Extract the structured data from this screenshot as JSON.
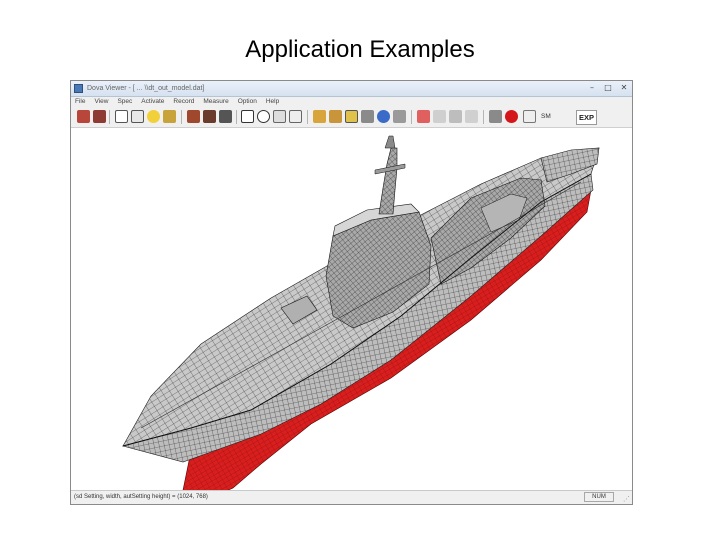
{
  "slide": {
    "title": "Application Examples"
  },
  "window": {
    "title": "Dova Viewer - [ ... \\\\dt_out_model.dat]",
    "buttons": {
      "minimize": "–",
      "maximize": "□",
      "close": "✕"
    }
  },
  "menu": [
    "File",
    "View",
    "Spec",
    "Activate",
    "Record",
    "Measure",
    "Option",
    "Help"
  ],
  "toolbar": {
    "icons": [
      "open-icon",
      "save-icon",
      "print-icon",
      "fit-view-icon",
      "zoom-window-icon",
      "light-icon",
      "settings-icon",
      "select-arrow-icon",
      "zoom-icon",
      "rotate-icon",
      "pan-icon",
      "measure-icon",
      "hide-icon",
      "section-icon",
      "wireframe-icon",
      "shade-icon",
      "color-icon",
      "stop-icon"
    ],
    "text_buttons": {
      "sm": "SM",
      "exp": "EXP"
    }
  },
  "status": {
    "text": "(sd Setting, width, autSetting height) = (1024, 768)",
    "num": "NUM"
  },
  "colors": {
    "hull_below_water": "#d91e1e",
    "hull_mesh": "#c8c8c8",
    "mesh_lines": "#222222",
    "titlebar": "#dbe6f3"
  }
}
